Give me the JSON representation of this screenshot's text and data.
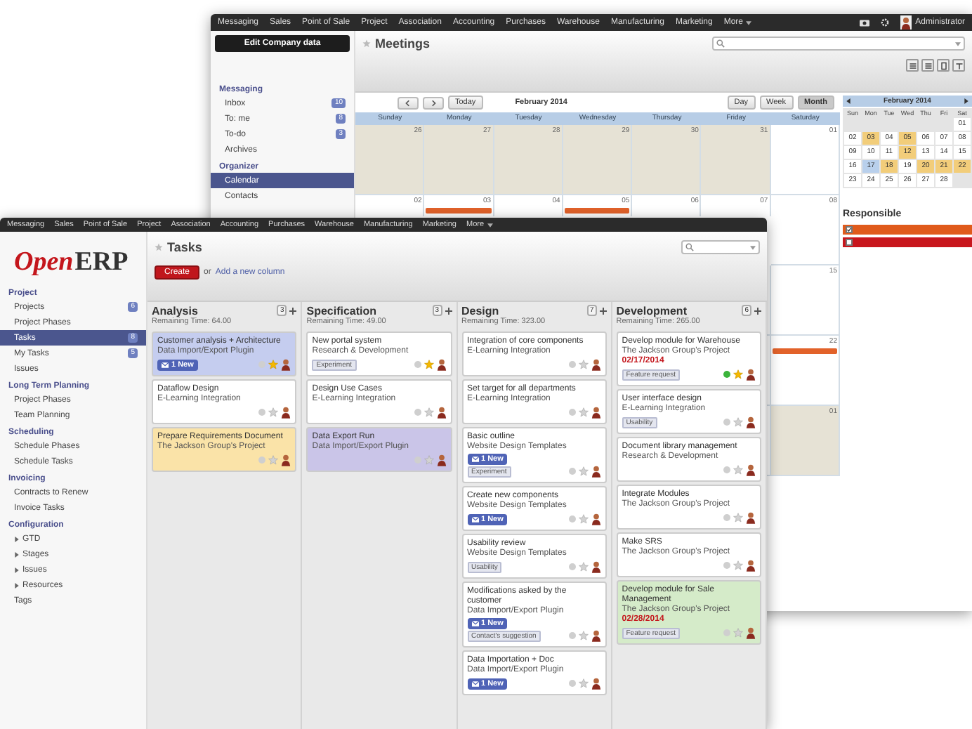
{
  "back_window": {
    "menu": [
      "Messaging",
      "Sales",
      "Point of Sale",
      "Project",
      "Association",
      "Accounting",
      "Purchases",
      "Warehouse",
      "Manufacturing",
      "Marketing",
      "More"
    ],
    "user": "Administrator",
    "tooltip": "Edit Company data",
    "sidebar": [
      {
        "heading": "Messaging",
        "items": [
          {
            "label": "Inbox",
            "badge": "10",
            "selected": false
          },
          {
            "label": "To: me",
            "badge": "8",
            "selected": false
          },
          {
            "label": "To-do",
            "badge": "3",
            "selected": false
          },
          {
            "label": "Archives",
            "selected": false
          }
        ]
      },
      {
        "heading": "Organizer",
        "items": [
          {
            "label": "Calendar",
            "selected": true
          },
          {
            "label": "Contacts",
            "selected": false
          }
        ]
      }
    ],
    "title": "Meetings",
    "calendar": {
      "today": "Today",
      "period": "February 2014",
      "modes": [
        {
          "label": "Day",
          "selected": false
        },
        {
          "label": "Week",
          "selected": false
        },
        {
          "label": "Month",
          "selected": true
        }
      ],
      "weekdays": [
        "Sunday",
        "Monday",
        "Tuesday",
        "Wednesday",
        "Thursday",
        "Friday",
        "Saturday"
      ],
      "weeks": [
        [
          {
            "n": "26",
            "shaded": true
          },
          {
            "n": "27",
            "shaded": true
          },
          {
            "n": "28",
            "shaded": true
          },
          {
            "n": "29",
            "shaded": true
          },
          {
            "n": "30",
            "shaded": true
          },
          {
            "n": "31",
            "shaded": true
          },
          {
            "n": "01",
            "shaded": false
          }
        ],
        [
          {
            "n": "02",
            "shaded": false
          },
          {
            "n": "03",
            "shaded": false,
            "events": [
              {
                "color": "#e2622a"
              }
            ]
          },
          {
            "n": "04",
            "shaded": false
          },
          {
            "n": "05",
            "shaded": false,
            "events": [
              {
                "color": "#e2622a"
              }
            ]
          },
          {
            "n": "06",
            "shaded": false
          },
          {
            "n": "07",
            "shaded": false
          },
          {
            "n": "08",
            "shaded": false
          }
        ],
        [
          {
            "n": "15",
            "shaded": false
          }
        ],
        [
          {
            "n": "22",
            "shaded": false,
            "events": [
              {
                "color": "#e2622a"
              }
            ]
          }
        ],
        [
          {
            "n": "01",
            "shaded": true
          }
        ]
      ]
    },
    "mini_calendar": {
      "title": "February 2014",
      "weekdays": [
        "Sun",
        "Mon",
        "Tue",
        "Wed",
        "Thu",
        "Fri",
        "Sat"
      ],
      "weeks": [
        [
          {
            "n": "01",
            "kind": "plain"
          }
        ],
        [
          {
            "n": "02",
            "kind": "plain"
          },
          {
            "n": "03",
            "kind": "busy"
          },
          {
            "n": "04",
            "kind": "plain"
          },
          {
            "n": "05",
            "kind": "busy"
          },
          {
            "n": "06",
            "kind": "plain"
          },
          {
            "n": "07",
            "kind": "plain"
          },
          {
            "n": "08",
            "kind": "plain"
          }
        ],
        [
          {
            "n": "09",
            "kind": "plain"
          },
          {
            "n": "10",
            "kind": "plain"
          },
          {
            "n": "11",
            "kind": "plain"
          },
          {
            "n": "12",
            "kind": "busy"
          },
          {
            "n": "13",
            "kind": "plain"
          },
          {
            "n": "14",
            "kind": "plain"
          },
          {
            "n": "15",
            "kind": "plain"
          }
        ],
        [
          {
            "n": "16",
            "kind": "plain"
          },
          {
            "n": "17",
            "kind": "today"
          },
          {
            "n": "18",
            "kind": "busy"
          },
          {
            "n": "19",
            "kind": "plain"
          },
          {
            "n": "20",
            "kind": "busy"
          },
          {
            "n": "21",
            "kind": "busy"
          },
          {
            "n": "22",
            "kind": "busy"
          }
        ],
        [
          {
            "n": "23",
            "kind": "plain"
          },
          {
            "n": "24",
            "kind": "plain"
          },
          {
            "n": "25",
            "kind": "plain"
          },
          {
            "n": "26",
            "kind": "plain"
          },
          {
            "n": "27",
            "kind": "plain"
          },
          {
            "n": "28",
            "kind": "plain"
          }
        ]
      ]
    },
    "responsible": {
      "title": "Responsible",
      "people": [
        {
          "color": "#e05a1b",
          "checked": true
        },
        {
          "color": "#c8161d",
          "checked": false
        }
      ]
    }
  },
  "front_window": {
    "menu": [
      "Messaging",
      "Sales",
      "Point of Sale",
      "Project",
      "Association",
      "Accounting",
      "Purchases",
      "Warehouse",
      "Manufacturing",
      "Marketing",
      "More"
    ],
    "logo": {
      "first": "Open",
      "second": "ERP"
    },
    "sidebar": [
      {
        "heading": "Project",
        "items": [
          {
            "label": "Projects",
            "badge": "6",
            "selected": false
          },
          {
            "label": "Project Phases",
            "selected": false
          },
          {
            "label": "Tasks",
            "badge": "8",
            "selected": true
          },
          {
            "label": "My Tasks",
            "badge": "5",
            "selected": false
          },
          {
            "label": "Issues",
            "selected": false
          }
        ]
      },
      {
        "heading": "Long Term Planning",
        "items": [
          {
            "label": "Project Phases",
            "selected": false
          },
          {
            "label": "Team Planning",
            "selected": false
          }
        ]
      },
      {
        "heading": "Scheduling",
        "items": [
          {
            "label": "Schedule Phases",
            "selected": false
          },
          {
            "label": "Schedule Tasks",
            "selected": false
          }
        ]
      },
      {
        "heading": "Invoicing",
        "items": [
          {
            "label": "Contracts to Renew",
            "selected": false
          },
          {
            "label": "Invoice Tasks",
            "selected": false
          }
        ]
      },
      {
        "heading": "Configuration",
        "items": [
          {
            "label": "GTD",
            "selected": false,
            "expanded": false
          },
          {
            "label": "Stages",
            "selected": false,
            "expanded": false
          },
          {
            "label": "Issues",
            "selected": false,
            "expanded": false
          },
          {
            "label": "Resources",
            "selected": false,
            "expanded": false
          },
          {
            "label": "Tags",
            "selected": false
          }
        ]
      }
    ],
    "title": "Tasks",
    "create": "Create",
    "or": "or",
    "add_column": "Add a new column",
    "columns": [
      {
        "name": "Analysis",
        "remaining": "Remaining Time: 64.00",
        "count": "3",
        "cards": [
          {
            "title": "Customer analysis + Architecture",
            "project": "Data Import/Export Plugin",
            "messages": "1 New",
            "color": "#c5cdef",
            "starred": true,
            "done": false
          },
          {
            "title": "Dataflow Design",
            "project": "E-Learning Integration",
            "color": "#ffffff",
            "starred": false,
            "done": false
          },
          {
            "title": "Prepare Requirements Document",
            "project": "The Jackson Group's Project",
            "color": "#fae3a8",
            "starred": false,
            "done": false
          }
        ]
      },
      {
        "name": "Specification",
        "remaining": "Remaining Time: 49.00",
        "count": "3",
        "cards": [
          {
            "title": "New portal system",
            "project": "Research & Development",
            "tag": "Experiment",
            "color": "#ffffff",
            "starred": true,
            "done": false
          },
          {
            "title": "Design Use Cases",
            "project": "E-Learning Integration",
            "color": "#ffffff",
            "starred": false,
            "done": false
          },
          {
            "title": "Data Export Run",
            "project": "Data Import/Export Plugin",
            "color": "#cac5e8",
            "starred": false,
            "done": false
          }
        ]
      },
      {
        "name": "Design",
        "remaining": "Remaining Time: 323.00",
        "count": "7",
        "cards": [
          {
            "title": "Integration of core components",
            "project": "E-Learning Integration",
            "color": "#ffffff",
            "starred": false,
            "done": false
          },
          {
            "title": "Set target for all departments",
            "project": "E-Learning Integration",
            "color": "#ffffff",
            "starred": false,
            "done": false
          },
          {
            "title": "Basic outline",
            "project": "Website Design Templates",
            "messages": "1 New",
            "tag": "Experiment",
            "color": "#ffffff",
            "starred": false,
            "done": false
          },
          {
            "title": "Create new components",
            "project": "Website Design Templates",
            "messages": "1 New",
            "color": "#ffffff",
            "starred": false,
            "done": false
          },
          {
            "title": "Usability review",
            "project": "Website Design Templates",
            "tag": "Usability",
            "color": "#ffffff",
            "starred": false,
            "done": false
          },
          {
            "title": "Modifications asked by the customer",
            "project": "Data Import/Export Plugin",
            "messages": "1 New",
            "tag": "Contact's suggestion",
            "color": "#ffffff",
            "starred": false,
            "done": false
          },
          {
            "title": "Data Importation + Doc",
            "project": "Data Import/Export Plugin",
            "messages": "1 New",
            "color": "#ffffff",
            "starred": false,
            "done": false
          }
        ]
      },
      {
        "name": "Development",
        "remaining": "Remaining Time: 265.00",
        "count": "6",
        "cards": [
          {
            "title": "Develop module for Warehouse",
            "project": "The Jackson Group's Project",
            "date": "02/17/2014",
            "tag": "Feature request",
            "color": "#ffffff",
            "starred": true,
            "done": true
          },
          {
            "title": "User interface design",
            "project": "E-Learning Integration",
            "tag": "Usability",
            "color": "#ffffff",
            "starred": false,
            "done": false
          },
          {
            "title": "Document library management",
            "project": "Research & Development",
            "color": "#ffffff",
            "starred": false,
            "done": false
          },
          {
            "title": "Integrate Modules",
            "project": "The Jackson Group's Project",
            "color": "#ffffff",
            "starred": false,
            "done": false
          },
          {
            "title": "Make SRS",
            "project": "The Jackson Group's Project",
            "color": "#ffffff",
            "starred": false,
            "done": false
          },
          {
            "title": "Develop module for Sale Management",
            "project": "The Jackson Group's Project",
            "date": "02/28/2014",
            "tag": "Feature request",
            "color": "#d5ebc9",
            "starred": false,
            "done": false
          }
        ]
      }
    ]
  }
}
